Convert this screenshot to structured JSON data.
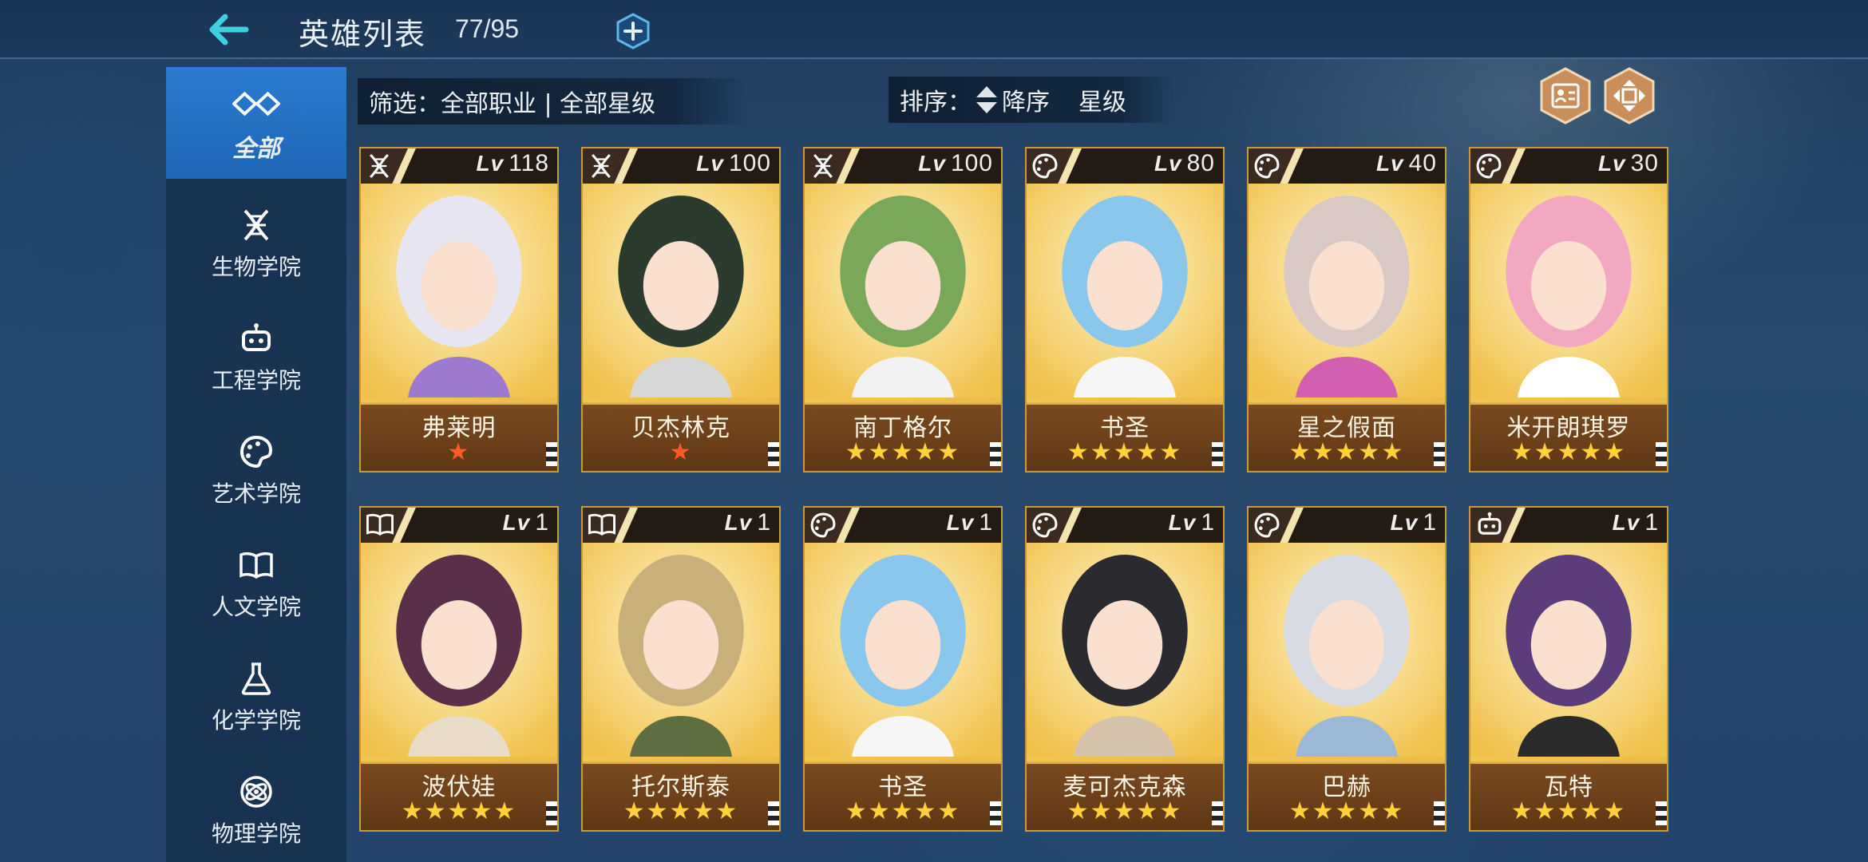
{
  "header": {
    "title": "英雄列表",
    "count": "77/95"
  },
  "sidebar": {
    "items": [
      {
        "label": "全部",
        "icon": "infinity-icon",
        "active": true
      },
      {
        "label": "生物学院",
        "icon": "dna-icon",
        "active": false
      },
      {
        "label": "工程学院",
        "icon": "robot-icon",
        "active": false
      },
      {
        "label": "艺术学院",
        "icon": "palette-icon",
        "active": false
      },
      {
        "label": "人文学院",
        "icon": "book-icon",
        "active": false
      },
      {
        "label": "化学学院",
        "icon": "flask-icon",
        "active": false
      },
      {
        "label": "物理学院",
        "icon": "atom-icon",
        "active": false
      }
    ]
  },
  "filter": {
    "text": "筛选：全部职业 | 全部星级"
  },
  "sort": {
    "prefix": "排序：",
    "order": "降序",
    "key": "星级"
  },
  "level_prefix": "Lv",
  "heroes": [
    {
      "name": "弗莱明",
      "level": "118",
      "stars": "★",
      "star_color": "red",
      "class_icon": "dna-icon"
    },
    {
      "name": "贝杰林克",
      "level": "100",
      "stars": "★",
      "star_color": "red",
      "class_icon": "dna-icon"
    },
    {
      "name": "南丁格尔",
      "level": "100",
      "stars": "★★★★★",
      "star_color": "gold",
      "class_icon": "dna-icon"
    },
    {
      "name": "书圣",
      "level": "80",
      "stars": "★★★★★",
      "star_color": "gold",
      "class_icon": "palette-icon"
    },
    {
      "name": "星之假面",
      "level": "40",
      "stars": "★★★★★",
      "star_color": "gold",
      "class_icon": "palette-icon"
    },
    {
      "name": "米开朗琪罗",
      "level": "30",
      "stars": "★★★★★",
      "star_color": "gold",
      "class_icon": "palette-icon"
    },
    {
      "name": "波伏娃",
      "level": "1",
      "stars": "★★★★★",
      "star_color": "gold",
      "class_icon": "book-icon"
    },
    {
      "name": "托尔斯泰",
      "level": "1",
      "stars": "★★★★★",
      "star_color": "gold",
      "class_icon": "book-icon"
    },
    {
      "name": "书圣",
      "level": "1",
      "stars": "★★★★★",
      "star_color": "gold",
      "class_icon": "palette-icon"
    },
    {
      "name": "麦可杰克森",
      "level": "1",
      "stars": "★★★★★",
      "star_color": "gold",
      "class_icon": "palette-icon"
    },
    {
      "name": "巴赫",
      "level": "1",
      "stars": "★★★★★",
      "star_color": "gold",
      "class_icon": "palette-icon"
    },
    {
      "name": "瓦特",
      "level": "1",
      "stars": "★★★★★",
      "star_color": "gold",
      "class_icon": "robot-icon"
    }
  ],
  "colors": {
    "accent": "#2b7bd0",
    "card_gold": "#f5cf5e",
    "name_bar": "#6b3f18",
    "back_arrow": "#3fd0e0"
  }
}
